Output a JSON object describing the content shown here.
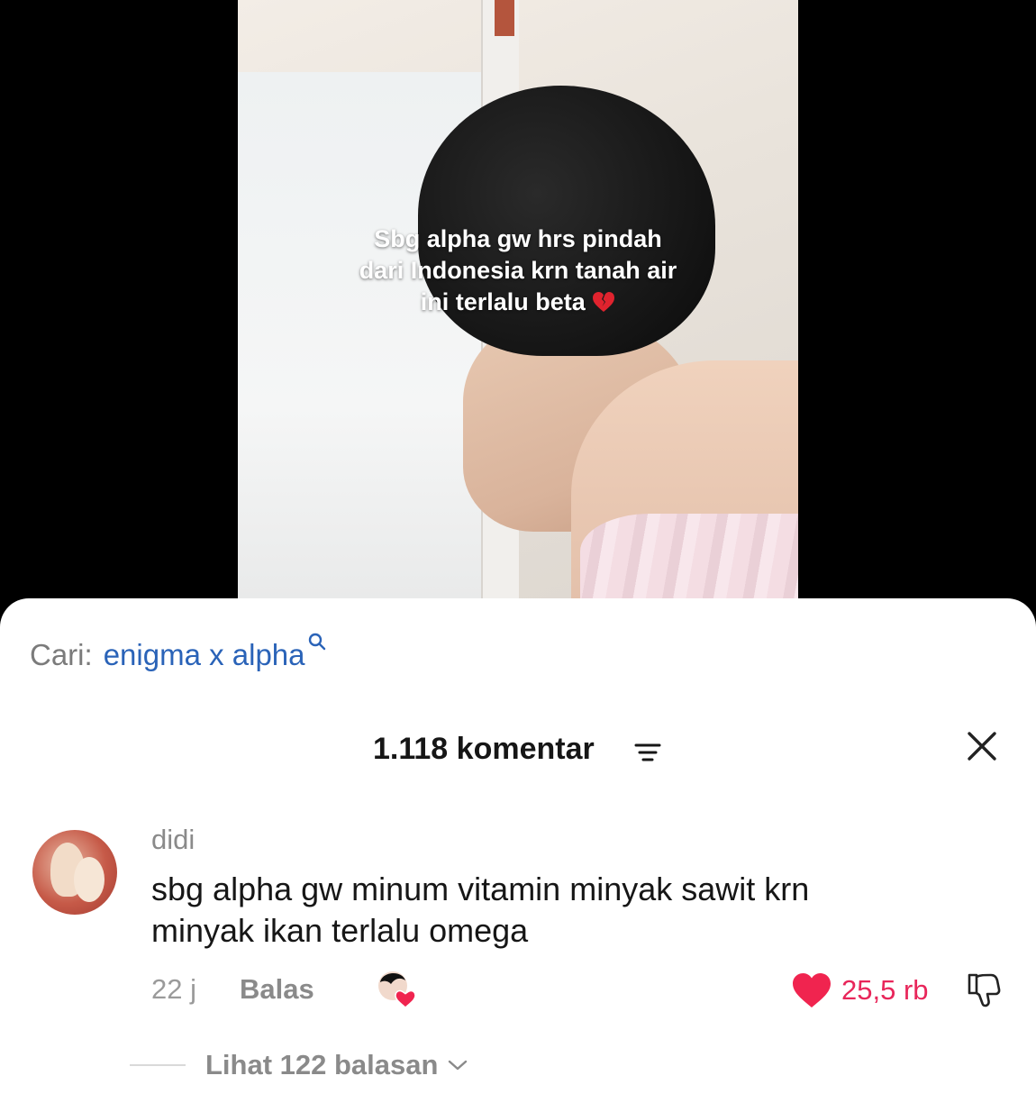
{
  "video": {
    "caption_lines": [
      "Sbg alpha gw hrs pindah",
      "dari Indonesia krn tanah air",
      "ini terlalu beta"
    ],
    "caption_emoji": "broken-heart-icon"
  },
  "search": {
    "prefix": "Cari:",
    "query": "enigma x alpha"
  },
  "comments_header": {
    "count_label": "1.118 komentar"
  },
  "comment": {
    "username": "didi",
    "text_lines": [
      "sbg alpha gw minum vitamin minyak sawit krn",
      "minyak ikan terlalu omega"
    ],
    "time": "22 j",
    "reply_label": "Balas",
    "like_count": "25,5 rb",
    "view_replies_label": "Lihat 122 balasan"
  },
  "colors": {
    "link_blue": "#2a63b8",
    "like_red": "#e8265a",
    "muted_text": "#8a8a8a"
  }
}
